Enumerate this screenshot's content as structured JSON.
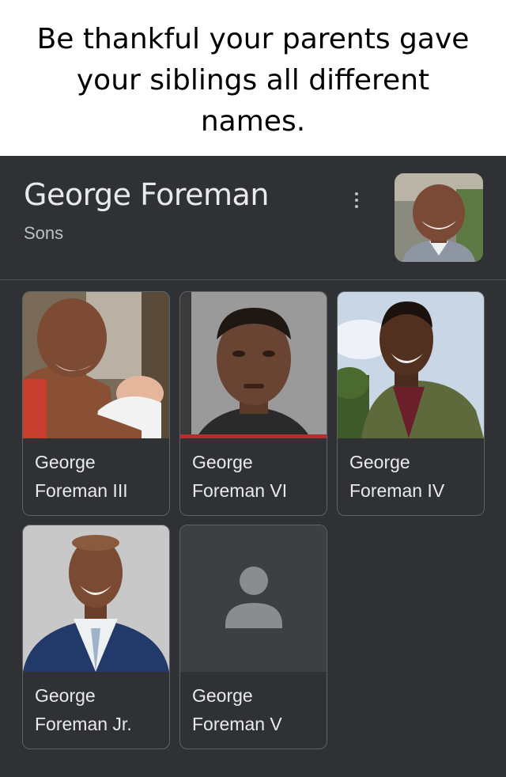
{
  "caption": {
    "line1": "Be thankful your parents gave",
    "line2": "your siblings all different",
    "line3": "names."
  },
  "panel": {
    "title": "George Foreman",
    "subtitle": "Sons",
    "more_icon": "more-vert-icon",
    "avatar_icon": "person-photo"
  },
  "sons": [
    {
      "name": "George Foreman III",
      "photo": "photo"
    },
    {
      "name": "George Foreman VI",
      "photo": "photo"
    },
    {
      "name": "George Foreman IV",
      "photo": "photo"
    },
    {
      "name": "George Foreman Jr.",
      "photo": "photo"
    },
    {
      "name": "George Foreman V",
      "photo": "person-placeholder-icon"
    }
  ],
  "colors": {
    "panel_bg": "#303134",
    "text": "#e8eaed",
    "subtext": "#bdc1c6",
    "border": "#5f6368"
  }
}
